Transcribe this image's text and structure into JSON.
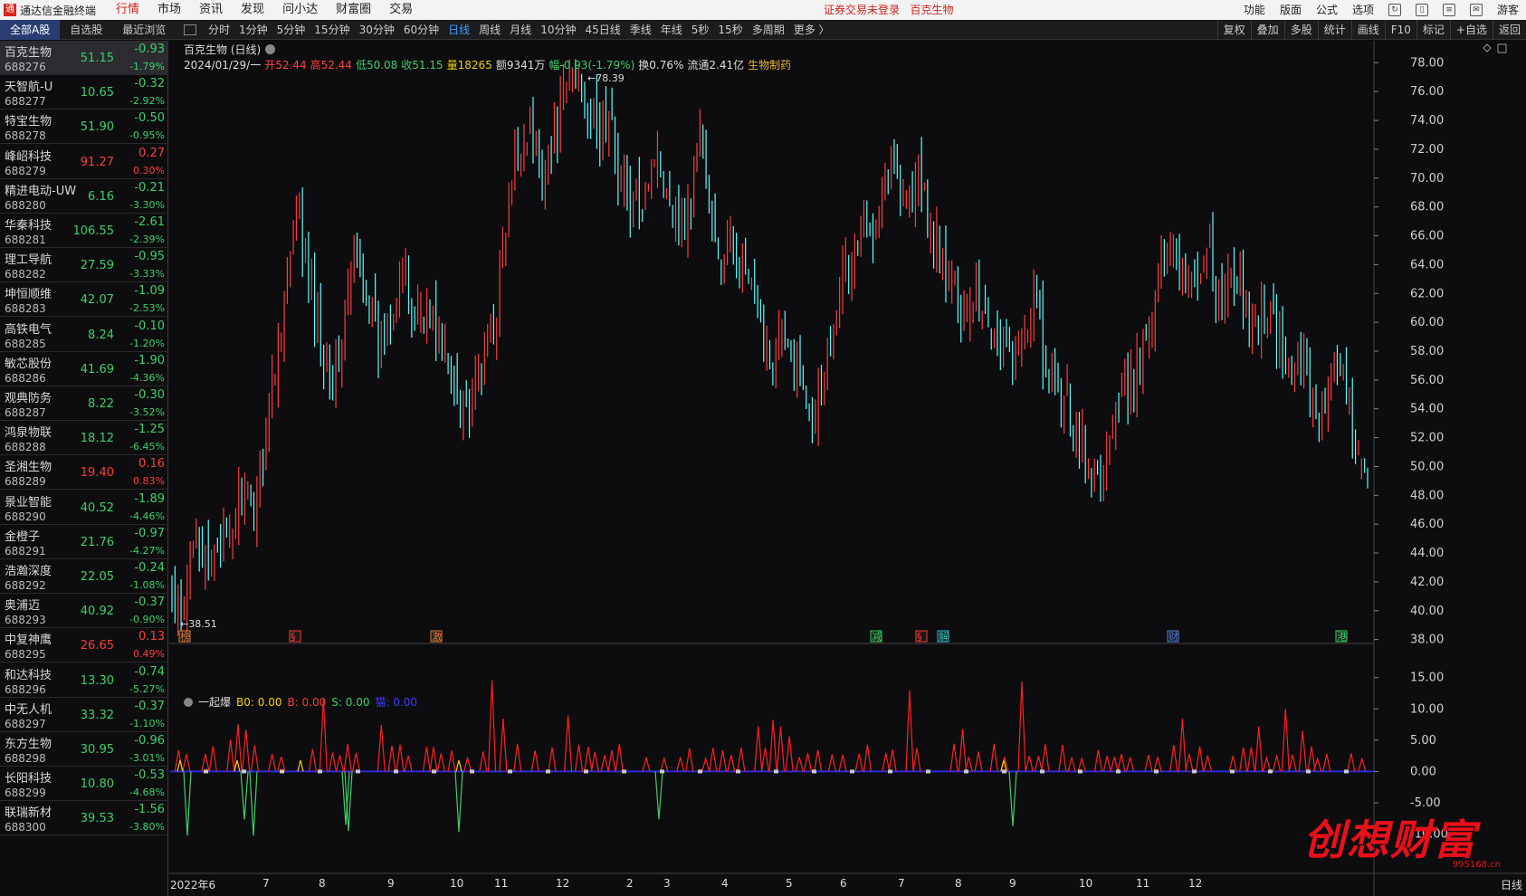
{
  "app": {
    "title": "通达信金融终端",
    "menus": [
      "行情",
      "市场",
      "资讯",
      "发现",
      "问小达",
      "财富圈",
      "交易"
    ],
    "active_menu": 0,
    "warning": "证券交易未登录",
    "warning_stock": "百克生物",
    "right_menus": [
      "功能",
      "版面",
      "公式",
      "选项"
    ],
    "user": "游客"
  },
  "list_tabs": [
    "全部A股",
    "自选股",
    "最近浏览"
  ],
  "periods": [
    "分时",
    "1分钟",
    "5分钟",
    "15分钟",
    "30分钟",
    "60分钟",
    "日线",
    "周线",
    "月线",
    "10分钟",
    "45日线",
    "季线",
    "年线",
    "5秒",
    "15秒",
    "多周期",
    "更多 〉"
  ],
  "active_period": 6,
  "tools": [
    "复权",
    "叠加",
    "多股",
    "统计",
    "画线",
    "F10",
    "标记",
    "+自选",
    "返回"
  ],
  "stocks": [
    {
      "name": "百克生物",
      "code": "688276",
      "price": "51.15",
      "change": "-0.93",
      "pct": "-1.79%",
      "dir": "dn"
    },
    {
      "name": "天智航-U",
      "code": "688277",
      "price": "10.65",
      "change": "-0.32",
      "pct": "-2.92%",
      "dir": "dn"
    },
    {
      "name": "特宝生物",
      "code": "688278",
      "price": "51.90",
      "change": "-0.50",
      "pct": "-0.95%",
      "dir": "dn"
    },
    {
      "name": "峰岹科技",
      "code": "688279",
      "price": "91.27",
      "change": "0.27",
      "pct": "0.30%",
      "dir": "up"
    },
    {
      "name": "精进电动-UW",
      "code": "688280",
      "price": "6.16",
      "change": "-0.21",
      "pct": "-3.30%",
      "dir": "dn"
    },
    {
      "name": "华秦科技",
      "code": "688281",
      "price": "106.55",
      "change": "-2.61",
      "pct": "-2.39%",
      "dir": "dn"
    },
    {
      "name": "理工导航",
      "code": "688282",
      "price": "27.59",
      "change": "-0.95",
      "pct": "-3.33%",
      "dir": "dn"
    },
    {
      "name": "坤恒顺维",
      "code": "688283",
      "price": "42.07",
      "change": "-1.09",
      "pct": "-2.53%",
      "dir": "dn"
    },
    {
      "name": "高铁电气",
      "code": "688285",
      "price": "8.24",
      "change": "-0.10",
      "pct": "-1.20%",
      "dir": "dn"
    },
    {
      "name": "敏芯股份",
      "code": "688286",
      "price": "41.69",
      "change": "-1.90",
      "pct": "-4.36%",
      "dir": "dn"
    },
    {
      "name": "观典防务",
      "code": "688287",
      "price": "8.22",
      "change": "-0.30",
      "pct": "-3.52%",
      "dir": "dn"
    },
    {
      "name": "鸿泉物联",
      "code": "688288",
      "price": "18.12",
      "change": "-1.25",
      "pct": "-6.45%",
      "dir": "dn"
    },
    {
      "name": "圣湘生物",
      "code": "688289",
      "price": "19.40",
      "change": "0.16",
      "pct": "0.83%",
      "dir": "up"
    },
    {
      "name": "景业智能",
      "code": "688290",
      "price": "40.52",
      "change": "-1.89",
      "pct": "-4.46%",
      "dir": "dn"
    },
    {
      "name": "金橙子",
      "code": "688291",
      "price": "21.76",
      "change": "-0.97",
      "pct": "-4.27%",
      "dir": "dn"
    },
    {
      "name": "浩瀚深度",
      "code": "688292",
      "price": "22.05",
      "change": "-0.24",
      "pct": "-1.08%",
      "dir": "dn"
    },
    {
      "name": "奥浦迈",
      "code": "688293",
      "price": "40.92",
      "change": "-0.37",
      "pct": "-0.90%",
      "dir": "dn"
    },
    {
      "name": "中复神鹰",
      "code": "688295",
      "price": "26.65",
      "change": "0.13",
      "pct": "0.49%",
      "dir": "up"
    },
    {
      "name": "和达科技",
      "code": "688296",
      "price": "13.30",
      "change": "-0.74",
      "pct": "-5.27%",
      "dir": "dn"
    },
    {
      "name": "中无人机",
      "code": "688297",
      "price": "33.32",
      "change": "-0.37",
      "pct": "-1.10%",
      "dir": "dn"
    },
    {
      "name": "东方生物",
      "code": "688298",
      "price": "30.95",
      "change": "-0.96",
      "pct": "-3.01%",
      "dir": "dn"
    },
    {
      "name": "长阳科技",
      "code": "688299",
      "price": "10.80",
      "change": "-0.53",
      "pct": "-4.68%",
      "dir": "dn"
    },
    {
      "name": "联瑞新材",
      "code": "688300",
      "price": "39.53",
      "change": "-1.56",
      "pct": "-3.80%",
      "dir": "dn"
    }
  ],
  "chart": {
    "title": "百克生物 (日线)",
    "info": {
      "date": "2024/01/29/一",
      "open": "开52.44",
      "high": "高52.44",
      "low": "低50.08",
      "close": "收51.15",
      "vol": "量18265",
      "amount": "额9341万",
      "range": "幅-0.93(-1.79%)",
      "turnover": "换0.76%",
      "float": "流通2.41亿",
      "industry": "生物制药"
    },
    "max_label": "78.39",
    "min_label": "38.51",
    "events": [
      {
        "label": "榜",
        "color": "#e07a3a"
      },
      {
        "label": "§",
        "color": "#ff3b3b"
      },
      {
        "label": "激",
        "color": "#e07a3a"
      },
      {
        "label": "减",
        "color": "#3bd06a"
      },
      {
        "label": "§",
        "color": "#ff3b3b"
      },
      {
        "label": "解",
        "color": "#30c0c0"
      },
      {
        "label": "财",
        "color": "#4a7ad8"
      },
      {
        "label": "港",
        "color": "#3bd06a"
      }
    ],
    "indicator": {
      "name": "一起爆",
      "b0": "B0: 0.00",
      "b": "B: 0.00",
      "s": "S: 0.00",
      "m": "猫: 0.00"
    },
    "x_labels": [
      "2022年6",
      "7",
      "8",
      "9",
      "10",
      "11",
      "12",
      "2",
      "3",
      "4",
      "5",
      "6",
      "7",
      "8",
      "9",
      "10",
      "11",
      "12"
    ],
    "bottom_right": "日线",
    "colors": {
      "up": "#ff3b3b",
      "down": "#54ffff",
      "axis": "#d0d0d0"
    }
  },
  "chart_data": {
    "type": "candlestick",
    "price_axis": {
      "ticks": [
        "78.00",
        "76.00",
        "74.00",
        "72.00",
        "70.00",
        "68.00",
        "66.00",
        "64.00",
        "62.00",
        "60.00",
        "58.00",
        "56.00",
        "54.00",
        "52.00",
        "50.00",
        "48.00",
        "46.00",
        "44.00",
        "42.00",
        "40.00",
        "38.00"
      ],
      "ylim": [
        37.5,
        79.5
      ]
    },
    "indicator_axis": {
      "ticks": [
        "15.00",
        "10.00",
        "5.00",
        "0.00",
        "-5.00",
        "-10.00"
      ],
      "ylim": [
        -11,
        18
      ]
    },
    "close_path": [
      41,
      39,
      47,
      42,
      45,
      44,
      49,
      46,
      52,
      57,
      63,
      67,
      62,
      59,
      56,
      60,
      65,
      62,
      58,
      61,
      64,
      60,
      62,
      59,
      57,
      55,
      54,
      57,
      60,
      66,
      72,
      74,
      71,
      72,
      75,
      78,
      76,
      73,
      74,
      70,
      68,
      69,
      72,
      70,
      67,
      68,
      74,
      66,
      64,
      66,
      63,
      60,
      58,
      59,
      57,
      56,
      54,
      58,
      63,
      64,
      66,
      67,
      70,
      71,
      68,
      70,
      66,
      64,
      62,
      61,
      63,
      60,
      59,
      57,
      58,
      62,
      56,
      55,
      54,
      52,
      49,
      50,
      53,
      55,
      57,
      60,
      64,
      66,
      64,
      62,
      66,
      61,
      63,
      62,
      60,
      61,
      59,
      57,
      58,
      55,
      54,
      56,
      55,
      52,
      50
    ]
  }
}
